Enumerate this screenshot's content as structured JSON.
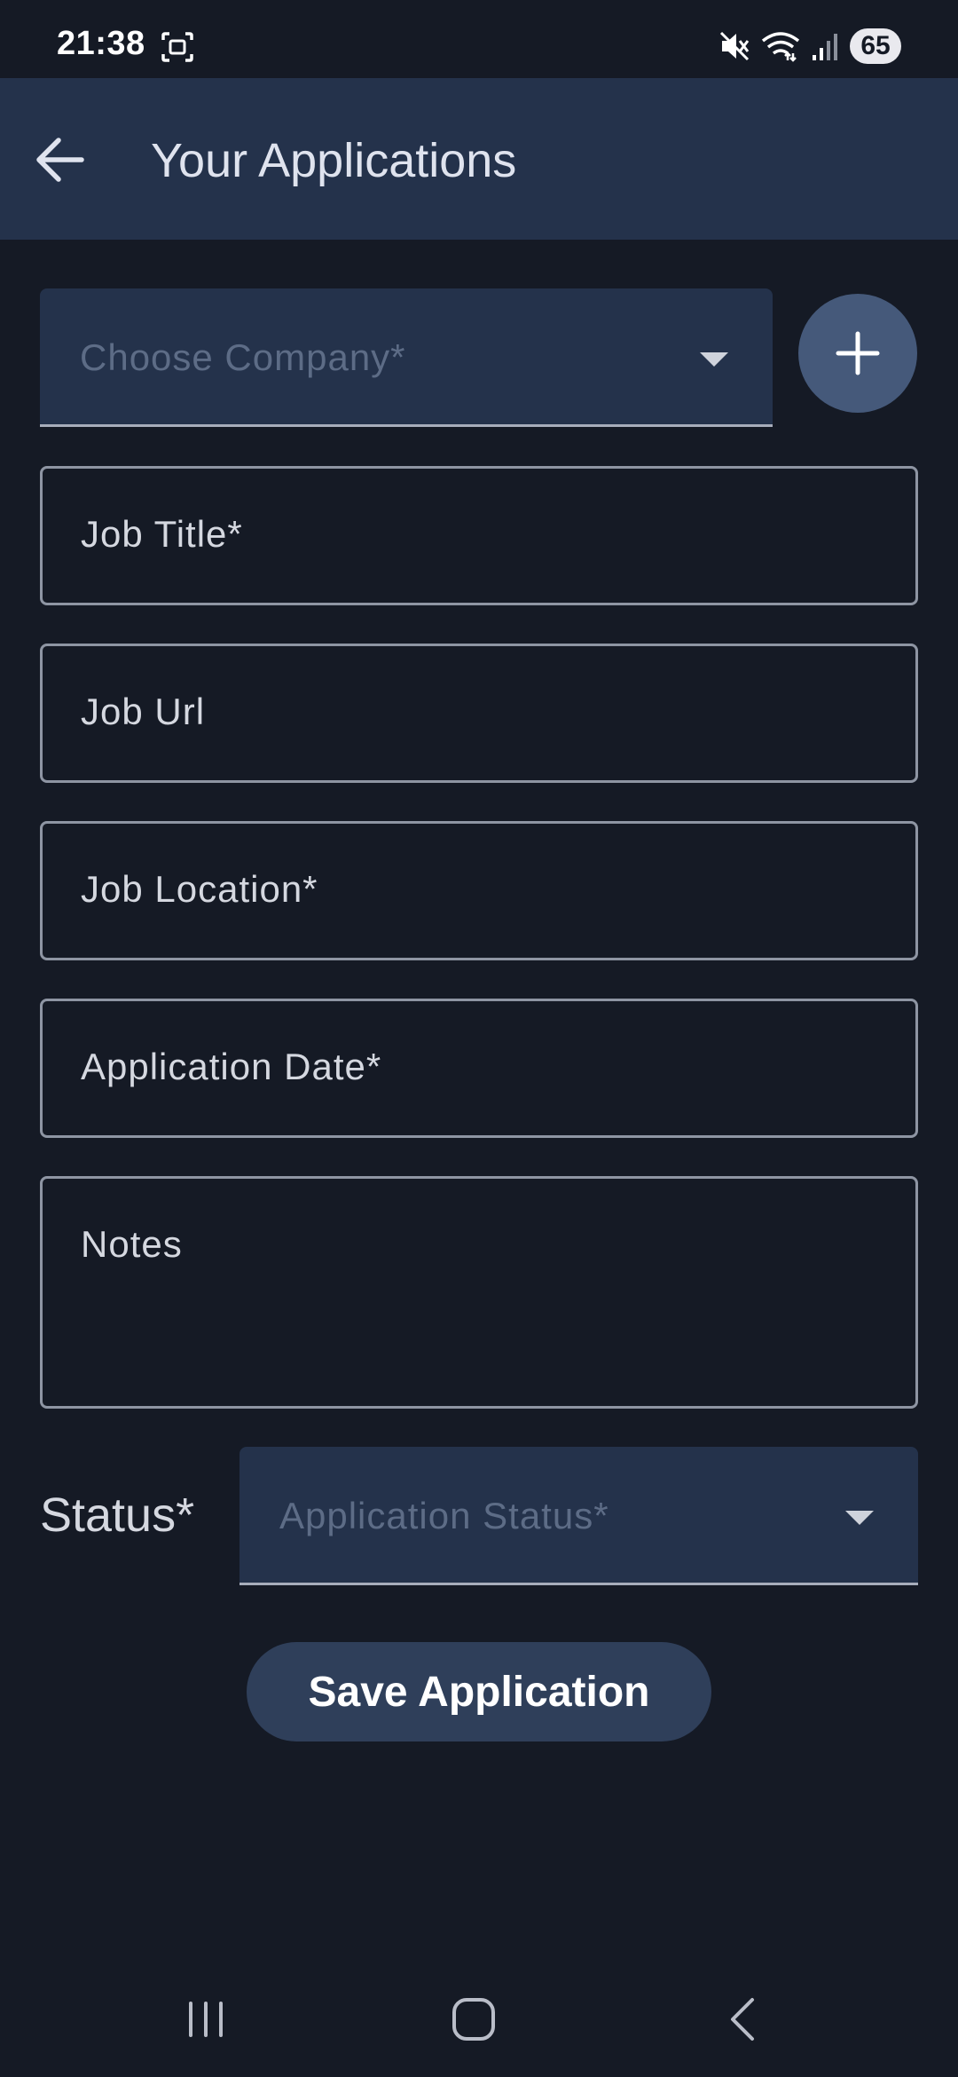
{
  "status_bar": {
    "time": "21:38",
    "battery": "65",
    "icons": [
      "screenshot-icon",
      "mute-icon",
      "wifi-icon",
      "signal-icon",
      "battery-icon"
    ]
  },
  "app_bar": {
    "title": "Your Applications",
    "back_icon": "arrow-left-icon"
  },
  "form": {
    "company_placeholder": "Choose Company*",
    "add_company_icon": "plus-icon",
    "job_title_label": "Job Title*",
    "job_url_label": "Job Url",
    "job_location_label": "Job Location*",
    "application_date_label": "Application Date*",
    "notes_label": "Notes",
    "status_label": "Status*",
    "status_placeholder": "Application Status*",
    "save_label": "Save Application"
  },
  "nav_bar": {
    "icons": [
      "recents-icon",
      "home-icon",
      "back-icon"
    ]
  },
  "colors": {
    "background": "#151a25",
    "app_bar": "#24324b",
    "fab": "#45597a",
    "button": "#2f3f5a",
    "outline": "#8e95a3",
    "placeholder": "#5d6c86"
  }
}
